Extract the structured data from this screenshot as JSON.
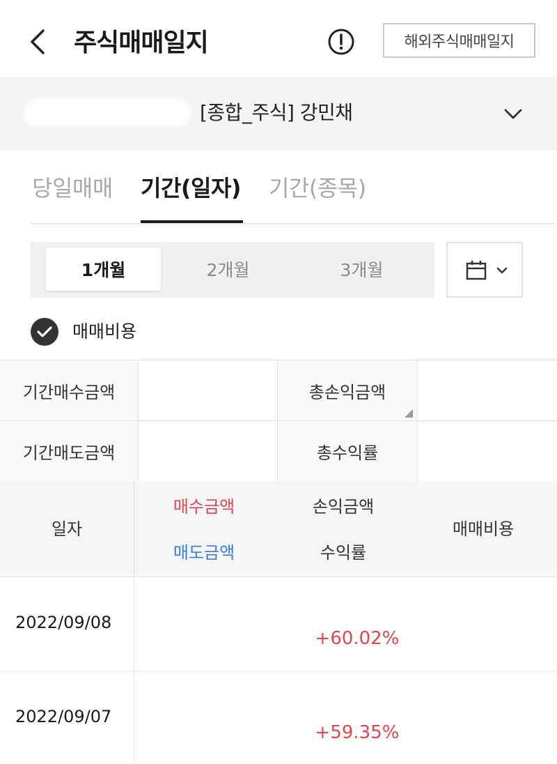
{
  "header": {
    "title": "주식매매일지",
    "back_icon": "chevron-left-icon",
    "info_icon": "exclamation-circle-icon",
    "overseas_label": "해외주식매매일지"
  },
  "account": {
    "name": "[종합_주식] 강민채",
    "dropdown_icon": "chevron-down-icon"
  },
  "tabs": [
    {
      "label": "당일매매",
      "active": false
    },
    {
      "label": "기간(일자)",
      "active": true
    },
    {
      "label": "기간(종목)",
      "active": false
    }
  ],
  "period": {
    "options": [
      {
        "label": "1개월",
        "active": true
      },
      {
        "label": "2개월",
        "active": false
      },
      {
        "label": "3개월",
        "active": false
      }
    ],
    "calendar_icon": "calendar-icon"
  },
  "fee_toggle": {
    "label": "매매비용",
    "checked": true
  },
  "summary": {
    "buy_label": "기간매수금액",
    "sell_label": "기간매도금액",
    "profit_label": "총손익금액",
    "rate_label": "총수익률"
  },
  "table": {
    "headers": {
      "date": "일자",
      "buy": "매수금액",
      "sell": "매도금액",
      "profit": "손익금액",
      "rate": "수익률",
      "fee": "매매비용"
    },
    "colors": {
      "buy": "#e1464f",
      "sell": "#3d7be0",
      "positive": "#e1464f"
    },
    "rows": [
      {
        "date": "2022/09/08",
        "rate": "+60.02%"
      },
      {
        "date": "2022/09/07",
        "rate": "+59.35%"
      }
    ]
  }
}
